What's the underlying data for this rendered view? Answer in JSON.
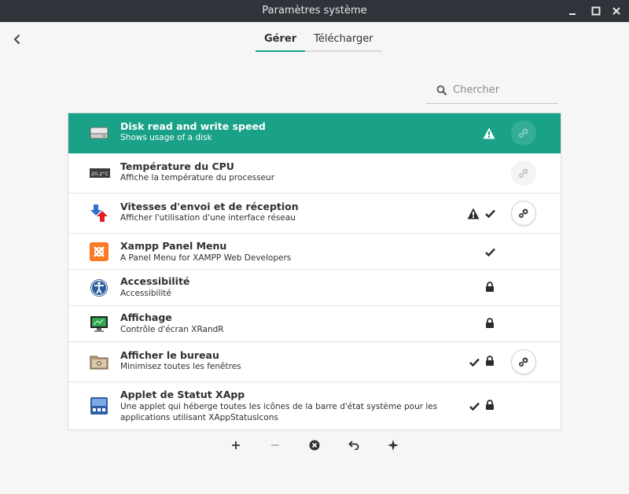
{
  "window": {
    "title": "Paramètres système"
  },
  "tabs": [
    {
      "label": "Gérer",
      "active": true
    },
    {
      "label": "Télécharger",
      "active": false
    }
  ],
  "search": {
    "placeholder": "Chercher",
    "value": ""
  },
  "colors": {
    "accent": "#1aa288",
    "titlebar": "#2f343b"
  },
  "applets": [
    {
      "name": "Disk read and write speed",
      "description": "Shows usage of a disk",
      "icon": "disk-drive-icon",
      "selected": true,
      "warning": true,
      "enabled": false,
      "locked": false,
      "configurable": false
    },
    {
      "name": "Température du CPU",
      "description": "Affiche la température du processeur",
      "icon": "cpu-temperature-icon",
      "icon_text": "20.2°C",
      "selected": false,
      "warning": false,
      "enabled": false,
      "locked": false,
      "configurable": false
    },
    {
      "name": "Vitesses d'envoi et de réception",
      "description": "Afficher l'utilisation d'une interface réseau",
      "icon": "network-arrows-icon",
      "selected": false,
      "warning": true,
      "enabled": true,
      "locked": false,
      "configurable": true
    },
    {
      "name": "Xampp Panel Menu",
      "description": "A Panel Menu for XAMPP Web Developers",
      "icon": "xampp-icon",
      "selected": false,
      "warning": false,
      "enabled": true,
      "locked": false,
      "configurable": false
    },
    {
      "name": "Accessibilité",
      "description": "Accessibilité",
      "icon": "accessibility-icon",
      "selected": false,
      "warning": false,
      "enabled": false,
      "locked": true,
      "configurable": false
    },
    {
      "name": "Affichage",
      "description": "Contrôle d'écran XRandR",
      "icon": "display-icon",
      "selected": false,
      "warning": false,
      "enabled": false,
      "locked": true,
      "configurable": false
    },
    {
      "name": "Afficher le bureau",
      "description": "Minimisez toutes les fenêtres",
      "icon": "show-desktop-icon",
      "selected": false,
      "warning": false,
      "enabled": true,
      "locked": true,
      "configurable": true
    },
    {
      "name": "Applet de Statut XApp",
      "description": "Une applet qui héberge toutes les icônes de la barre d'état système pour les applications utilisant XAppStatusIcons",
      "icon": "xapp-status-icon",
      "selected": false,
      "warning": false,
      "enabled": true,
      "locked": true,
      "configurable": false
    }
  ],
  "toolbar": [
    "add-icon",
    "remove-icon",
    "uninstall-icon",
    "restore-icon",
    "more-applets-icon"
  ]
}
